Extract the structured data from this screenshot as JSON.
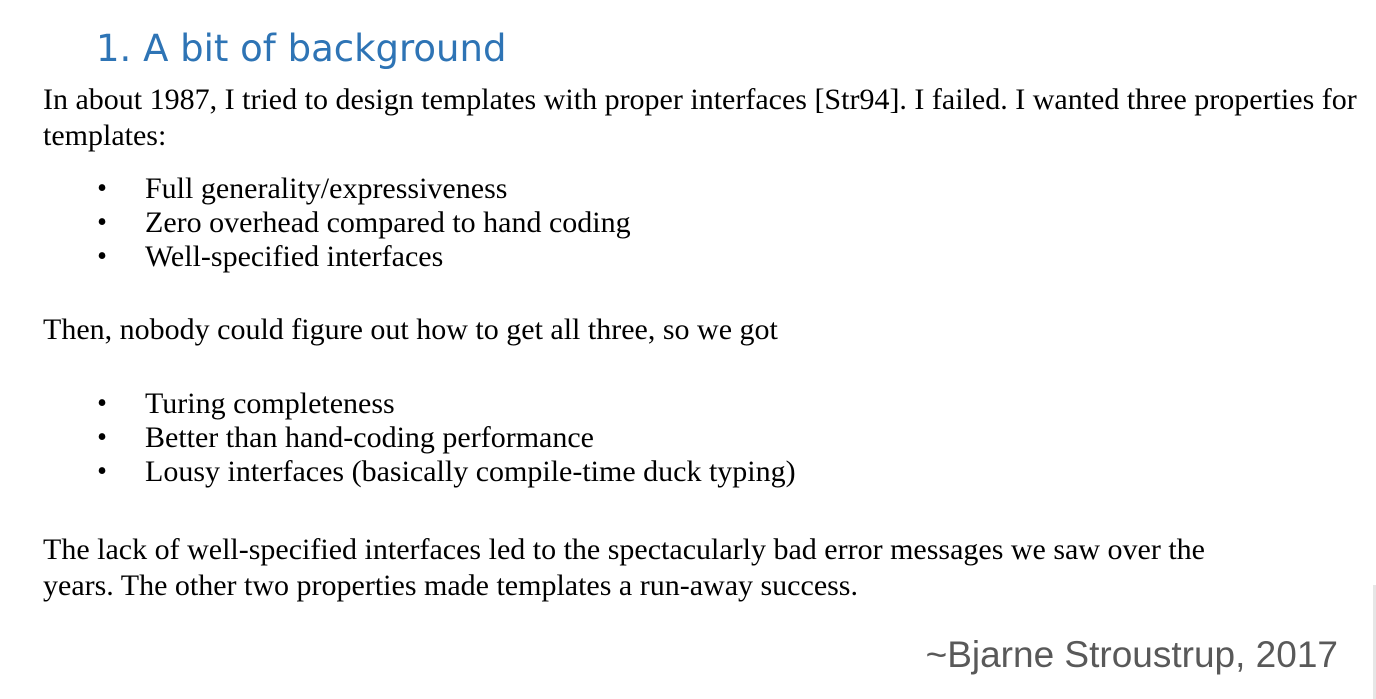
{
  "heading": "1.  A bit of background",
  "paragraph1": "In about 1987, I tried to design templates with proper interfaces [Str94]. I failed. I wanted three properties for templates:",
  "list1": [
    "Full generality/expressiveness",
    "Zero overhead compared to hand coding",
    "Well-specified interfaces"
  ],
  "paragraph2": "Then, nobody could figure out how to get all three, so we got",
  "list2": [
    "Turing completeness",
    "Better than hand-coding performance",
    "Lousy interfaces (basically compile-time duck typing)"
  ],
  "paragraph3_line1": "The lack of well-specified interfaces led to the spectacularly bad error messages we saw over the",
  "paragraph3_line2": "years. The other two properties made templates a run-away success.",
  "bullet_glyph": "•",
  "attribution": "~Bjarne Stroustrup, 2017"
}
